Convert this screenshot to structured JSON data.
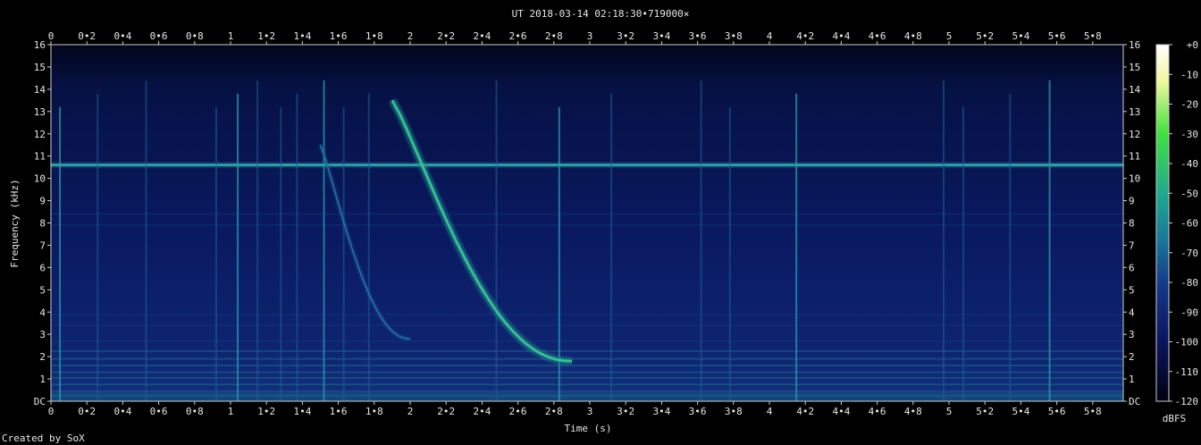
{
  "title": "UT 2018-03-14 02:18:30•719000×",
  "credit": "Created by SoX",
  "chart_data": {
    "type": "heatmap",
    "title": "UT 2018-03-14 02:18:30•719000×",
    "xlabel": "Time (s)",
    "ylabel": "Frequency (kHz)",
    "xlim": [
      0,
      5.97
    ],
    "ylim": [
      0,
      16
    ],
    "x_ticks": [
      "0",
      "0•2",
      "0•4",
      "0•6",
      "0•8",
      "1",
      "1•2",
      "1•4",
      "1•6",
      "1•8",
      "2",
      "2•2",
      "2•4",
      "2•6",
      "2•8",
      "3",
      "3•2",
      "3•4",
      "3•6",
      "3•8",
      "4",
      "4•2",
      "4•4",
      "4•6",
      "4•8",
      "5",
      "5•2",
      "5•4",
      "5•6",
      "5•8"
    ],
    "y_ticks": [
      "DC",
      "1",
      "2",
      "3",
      "4",
      "5",
      "6",
      "7",
      "8",
      "9",
      "10",
      "11",
      "12",
      "13",
      "14",
      "15",
      "16"
    ],
    "colorbar": {
      "label": "dBFS",
      "ticks": [
        "+0",
        "-10",
        "-20",
        "-30",
        "-40",
        "-50",
        "-60",
        "-70",
        "-80",
        "-90",
        "-100",
        "-110",
        "-120"
      ],
      "range": [
        -120,
        0
      ]
    },
    "features": {
      "horizontal_line_khz": 10.6,
      "whistlers": [
        {
          "name": "strong",
          "t_start": 1.9,
          "f_start": 13.5,
          "t_end": 2.9,
          "f_end": 1.8
        },
        {
          "name": "faint",
          "t_start": 1.5,
          "f_start": 11.5,
          "t_end": 2.0,
          "f_end": 2.8
        }
      ],
      "spherics_s": [
        0.05,
        0.26,
        0.53,
        0.92,
        1.04,
        1.15,
        1.28,
        1.37,
        1.52,
        1.63,
        1.77,
        2.48,
        2.83,
        3.12,
        3.62,
        3.78,
        4.15,
        4.97,
        5.08,
        5.34,
        5.56
      ]
    },
    "grid": false,
    "legend": "colorbar right"
  },
  "colors": {
    "background": "#000000",
    "plot_base": "#050c3a",
    "colormap": [
      "#000010",
      "#0a1560",
      "#143a8a",
      "#18769a",
      "#20a890",
      "#40e040",
      "#f4f8a0",
      "#ffffff"
    ]
  }
}
